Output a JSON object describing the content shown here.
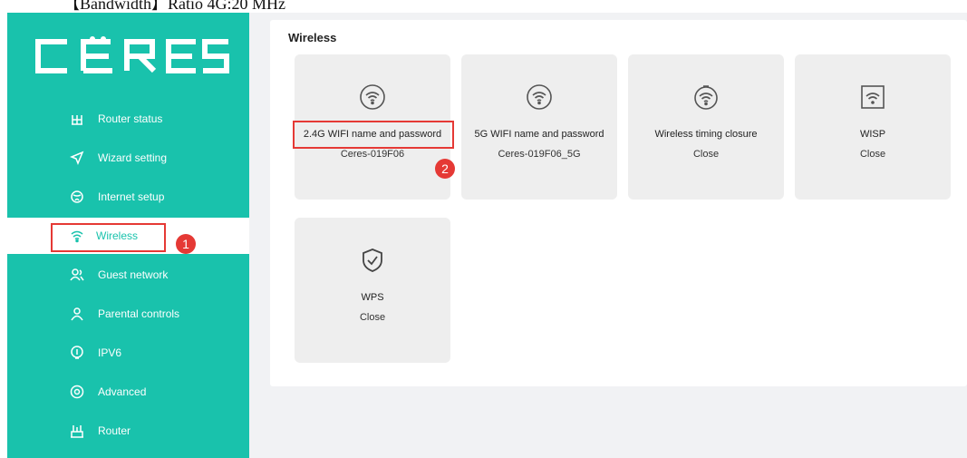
{
  "top_text": "【Bandwidth】Ratio 4G:20 MHz",
  "sidebar": {
    "logo_text": "CERES",
    "items": [
      {
        "label": "Router status",
        "icon": "router-status-icon"
      },
      {
        "label": "Wizard setting",
        "icon": "wizard-icon"
      },
      {
        "label": "Internet setup",
        "icon": "globe-icon"
      },
      {
        "label": "Wireless",
        "icon": "wifi-icon",
        "active": true
      },
      {
        "label": "Guest network",
        "icon": "guest-icon"
      },
      {
        "label": "Parental controls",
        "icon": "parental-icon"
      },
      {
        "label": "IPV6",
        "icon": "ipv6-icon"
      },
      {
        "label": "Advanced",
        "icon": "advanced-icon"
      },
      {
        "label": "Router",
        "icon": "router-icon"
      }
    ]
  },
  "main": {
    "section_title": "Wireless",
    "cards": [
      {
        "title": "2.4G WIFI name and password",
        "value": "Ceres-019F06",
        "icon": "wifi-circle-icon"
      },
      {
        "title": "5G WIFI name and password",
        "value": "Ceres-019F06_5G",
        "icon": "wifi-circle-icon"
      },
      {
        "title": "Wireless timing closure",
        "value": "Close",
        "icon": "wifi-timer-icon"
      },
      {
        "title": "WISP",
        "value": "Close",
        "icon": "wisp-icon"
      },
      {
        "title": "WPS",
        "value": "Close",
        "icon": "shield-check-icon"
      }
    ]
  },
  "annotations": {
    "badge1": "1",
    "badge2": "2"
  },
  "colors": {
    "accent": "#19c2ac",
    "highlight": "#e53935",
    "card_bg": "#eeeeee",
    "page_bg": "#f1f2f4"
  }
}
